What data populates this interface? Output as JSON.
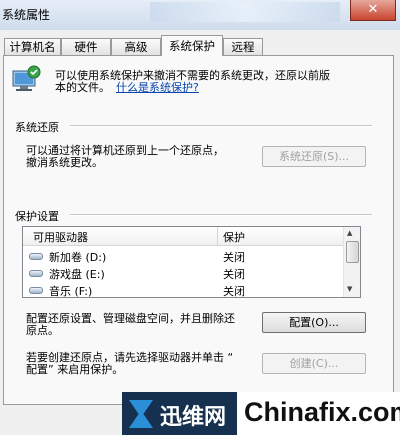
{
  "window": {
    "title": "系统属性",
    "close_glyph": "✕"
  },
  "tabs": [
    "计算机名",
    "硬件",
    "高级",
    "系统保护",
    "远程"
  ],
  "intro": {
    "line1": "可以使用系统保护来撤消不需要的系统更改，还原以前版",
    "line2": "本的文件。",
    "link": "什么是系统保护?"
  },
  "restore": {
    "group_label": "系统还原",
    "text_line1": "可以通过将计算机还原到上一个还原点，",
    "text_line2": "撤消系统更改。",
    "button": "系统还原(S)..."
  },
  "protection": {
    "group_label": "保护设置",
    "columns": [
      "可用驱动器",
      "保护"
    ],
    "drives": [
      {
        "name": "新加卷 (D:)",
        "status": "关闭"
      },
      {
        "name": "游戏盘 (E:)",
        "status": "关闭"
      },
      {
        "name": "音乐 (F:)",
        "status": "关闭"
      }
    ],
    "config_line1": "配置还原设置、管理磁盘空间，并且删除还",
    "config_line2": "原点。",
    "config_button": "配置(O)...",
    "create_line1": "若要创建还原点，请先选择驱动器并单击 “",
    "create_line2": "配置” 来启用保护。",
    "create_button": "创建(C)..."
  },
  "watermark": {
    "logo_text": "迅维网",
    "site": "Chinafix.com"
  }
}
